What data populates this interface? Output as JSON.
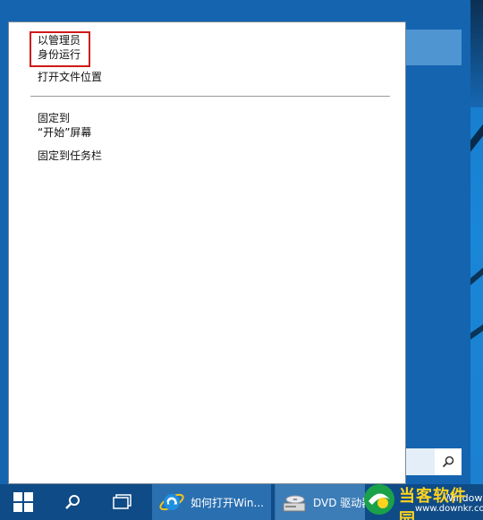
{
  "context_menu": {
    "run_as_admin_line1": "以管理员",
    "run_as_admin_line2": "身份运行",
    "open_file_location": "打开文件位置",
    "pin_to_start_line1": "固定到",
    "pin_to_start_line2": "“开始”屏幕",
    "pin_to_taskbar": "固定到任务栏"
  },
  "taskbar": {
    "ie_task_label": "如何打开Win...",
    "dvd_task_label": "DVD 驱动器",
    "partial_right_label": "Windows"
  },
  "watermark": {
    "brand_name": "当客软件园",
    "brand_url": "www.downkr.com"
  },
  "colors": {
    "accent_red": "#d01818",
    "taskbar": "#0f4b86",
    "start_panel": "#1464b0"
  }
}
